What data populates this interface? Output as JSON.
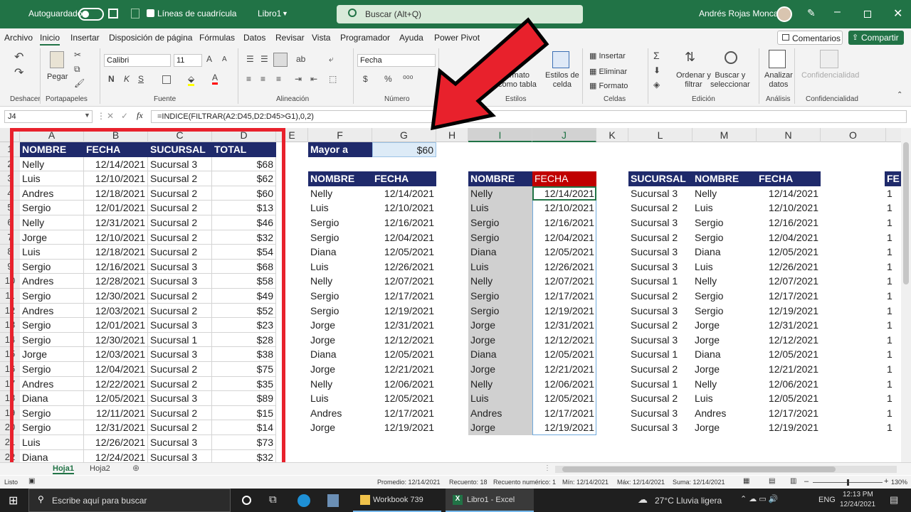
{
  "titlebar": {
    "autosave_label": "Autoguardado",
    "gridlines_label": "Líneas de cuadrícula",
    "workbook_name": "Libro1",
    "search_placeholder": "Buscar (Alt+Q)",
    "user_name": "Andrés Rojas Moncada"
  },
  "menu": {
    "tabs": [
      "Archivo",
      "Inicio",
      "Insertar",
      "Disposición de página",
      "Fórmulas",
      "Datos",
      "Revisar",
      "Vista",
      "Programador",
      "Ayuda",
      "Power Pivot"
    ],
    "comments_label": "Comentarios",
    "share_label": "Compartir"
  },
  "ribbon": {
    "undo_label": "Deshacer",
    "paste_label": "Pegar",
    "clipboard_label": "Portapapeles",
    "font_name": "Calibri",
    "font_size": "11",
    "font_label": "Fuente",
    "alignment_label": "Alineación",
    "number_format": "Fecha",
    "number_label": "Número",
    "table_format_label_1": "r formato",
    "table_format_label_2": "como tabla",
    "cell_styles_label_1": "Estilos de",
    "cell_styles_label_2": "celda",
    "styles_label": "Estilos",
    "insert_label": "Insertar",
    "delete_label": "Eliminar",
    "format_label": "Formato",
    "cells_label": "Celdas",
    "sort_label_1": "Ordenar y",
    "sort_label_2": "filtrar",
    "find_label_1": "Buscar y",
    "find_label_2": "seleccionar",
    "editing_label": "Edición",
    "analyze_label_1": "Analizar",
    "analyze_label_2": "datos",
    "analysis_label": "Análisis",
    "confidential_btn": "Confidencialidad",
    "confidential_label": "Confidencialidad"
  },
  "formula_bar": {
    "name_box": "J4",
    "fx": "fx",
    "formula": "=INDICE(FILTRAR(A2:D45,D2:D45>G1),0,2)"
  },
  "columns": [
    "A",
    "B",
    "C",
    "D",
    "E",
    "F",
    "G",
    "H",
    "I",
    "J",
    "K",
    "L",
    "M",
    "N",
    "O"
  ],
  "rows": [
    "1",
    "2",
    "3",
    "4",
    "5",
    "6",
    "7",
    "8",
    "9",
    "10",
    "11",
    "12",
    "13",
    "14",
    "15",
    "16",
    "17",
    "18",
    "19",
    "20",
    "21",
    "22"
  ],
  "table1": {
    "headers": [
      "NOMBRE",
      "FECHA",
      "SUCURSAL",
      "TOTAL"
    ],
    "rows": [
      [
        "Nelly",
        "12/14/2021",
        "Sucursal 3",
        "$68"
      ],
      [
        "Luis",
        "12/10/2021",
        "Sucursal 2",
        "$62"
      ],
      [
        "Andres",
        "12/18/2021",
        "Sucursal 2",
        "$60"
      ],
      [
        "Sergio",
        "12/01/2021",
        "Sucursal 2",
        "$13"
      ],
      [
        "Nelly",
        "12/31/2021",
        "Sucursal 2",
        "$46"
      ],
      [
        "Jorge",
        "12/10/2021",
        "Sucursal 2",
        "$32"
      ],
      [
        "Luis",
        "12/18/2021",
        "Sucursal 2",
        "$54"
      ],
      [
        "Sergio",
        "12/16/2021",
        "Sucursal 3",
        "$68"
      ],
      [
        "Andres",
        "12/28/2021",
        "Sucursal 3",
        "$58"
      ],
      [
        "Sergio",
        "12/30/2021",
        "Sucursal 2",
        "$49"
      ],
      [
        "Andres",
        "12/03/2021",
        "Sucursal 2",
        "$52"
      ],
      [
        "Sergio",
        "12/01/2021",
        "Sucursal 3",
        "$23"
      ],
      [
        "Sergio",
        "12/30/2021",
        "Sucursal 1",
        "$28"
      ],
      [
        "Jorge",
        "12/03/2021",
        "Sucursal 3",
        "$38"
      ],
      [
        "Sergio",
        "12/04/2021",
        "Sucursal 2",
        "$75"
      ],
      [
        "Andres",
        "12/22/2021",
        "Sucursal 2",
        "$35"
      ],
      [
        "Diana",
        "12/05/2021",
        "Sucursal 3",
        "$89"
      ],
      [
        "Sergio",
        "12/11/2021",
        "Sucursal 2",
        "$15"
      ],
      [
        "Sergio",
        "12/31/2021",
        "Sucursal 2",
        "$14"
      ],
      [
        "Luis",
        "12/26/2021",
        "Sucursal 3",
        "$73"
      ],
      [
        "Diana",
        "12/24/2021",
        "Sucursal 3",
        "$32"
      ]
    ]
  },
  "criteria": {
    "label": "Mayor a",
    "value": "$60"
  },
  "results": {
    "headers_f": [
      "NOMBRE",
      "FECHA"
    ],
    "headers_i": [
      "NOMBRE",
      "FECHA"
    ],
    "headers_l": [
      "SUCURSAL",
      "NOMBRE",
      "FECHA"
    ],
    "header_p_partial": "FE",
    "names": [
      "Nelly",
      "Luis",
      "Sergio",
      "Sergio",
      "Diana",
      "Luis",
      "Nelly",
      "Sergio",
      "Sergio",
      "Jorge",
      "Jorge",
      "Diana",
      "Jorge",
      "Nelly",
      "Luis",
      "Andres",
      "Jorge"
    ],
    "dates": [
      "12/14/2021",
      "12/10/2021",
      "12/16/2021",
      "12/04/2021",
      "12/05/2021",
      "12/26/2021",
      "12/07/2021",
      "12/17/2021",
      "12/19/2021",
      "12/31/2021",
      "12/12/2021",
      "12/05/2021",
      "12/21/2021",
      "12/06/2021",
      "12/05/2021",
      "12/17/2021",
      "12/19/2021"
    ],
    "branches": [
      "Sucursal 3",
      "Sucursal 2",
      "Sucursal 3",
      "Sucursal 2",
      "Sucursal 3",
      "Sucursal 3",
      "Sucursal 1",
      "Sucursal 2",
      "Sucursal 3",
      "Sucursal 2",
      "Sucursal 3",
      "Sucursal 1",
      "Sucursal 2",
      "Sucursal 1",
      "Sucursal 2",
      "Sucursal 3",
      "Sucursal 3"
    ],
    "partial_o": "1"
  },
  "sheets": [
    "Hoja1",
    "Hoja2"
  ],
  "status": {
    "mode": "Listo",
    "average": "Promedio: 12/14/2021",
    "count": "Recuento: 18",
    "num_count": "Recuento numérico: 1",
    "min": "Mín: 12/14/2021",
    "max": "Máx: 12/14/2021",
    "sum": "Suma: 12/14/2021",
    "zoom": "130%"
  },
  "taskbar": {
    "search_placeholder": "Escribe aquí para buscar",
    "app1": "Workbook 739",
    "app2": "Libro1 - Excel",
    "weather": "27°C  Lluvia ligera",
    "lang": "ENG",
    "time": "12:13 PM",
    "date": "12/24/2021"
  },
  "colors": {
    "excel_green": "#217346",
    "header_navy": "#1f2a6b",
    "header_red": "#c00000",
    "annotation_red": "#e8212c",
    "criteria_blue": "#ddebf7"
  }
}
